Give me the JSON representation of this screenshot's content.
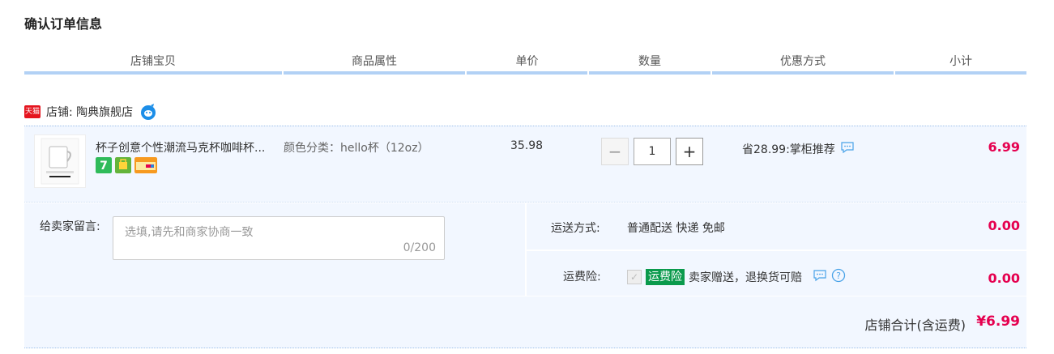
{
  "page": {
    "title": "确认订单信息"
  },
  "table": {
    "headers": [
      "店铺宝贝",
      "商品属性",
      "单价",
      "数量",
      "优惠方式",
      "小计"
    ]
  },
  "shop": {
    "badge": "天猫",
    "label": "店铺: 陶典旗舰店"
  },
  "item": {
    "name": "杯子创意个性潮流马克杯咖啡杯...",
    "attribute": "颜色分类：hello杯（12oz）",
    "price": "35.98",
    "quantity": "1",
    "minus": "−",
    "plus": "+",
    "promo": "省28.99:掌柜推荐",
    "subtotal": "6.99",
    "service_badges": [
      "7",
      "icon",
      "card"
    ]
  },
  "message": {
    "label": "给卖家留言:",
    "placeholder": "选填,请先和商家协商一致",
    "count": "0/200"
  },
  "shipping": {
    "label": "运送方式:",
    "value": "普通配送 快递 免邮",
    "fee": "0.00"
  },
  "insurance": {
    "label": "运费险:",
    "badge": "运费险",
    "desc": "卖家赠送，退换货可赔",
    "fee": "0.00"
  },
  "total": {
    "label": "店铺合计(含运费)",
    "value": "¥6.99"
  },
  "colors": {
    "accent": "#e5004f",
    "header_border": "#b2d1f5",
    "panel_bg": "#f2f7ff",
    "green": "#0a9a4c"
  }
}
